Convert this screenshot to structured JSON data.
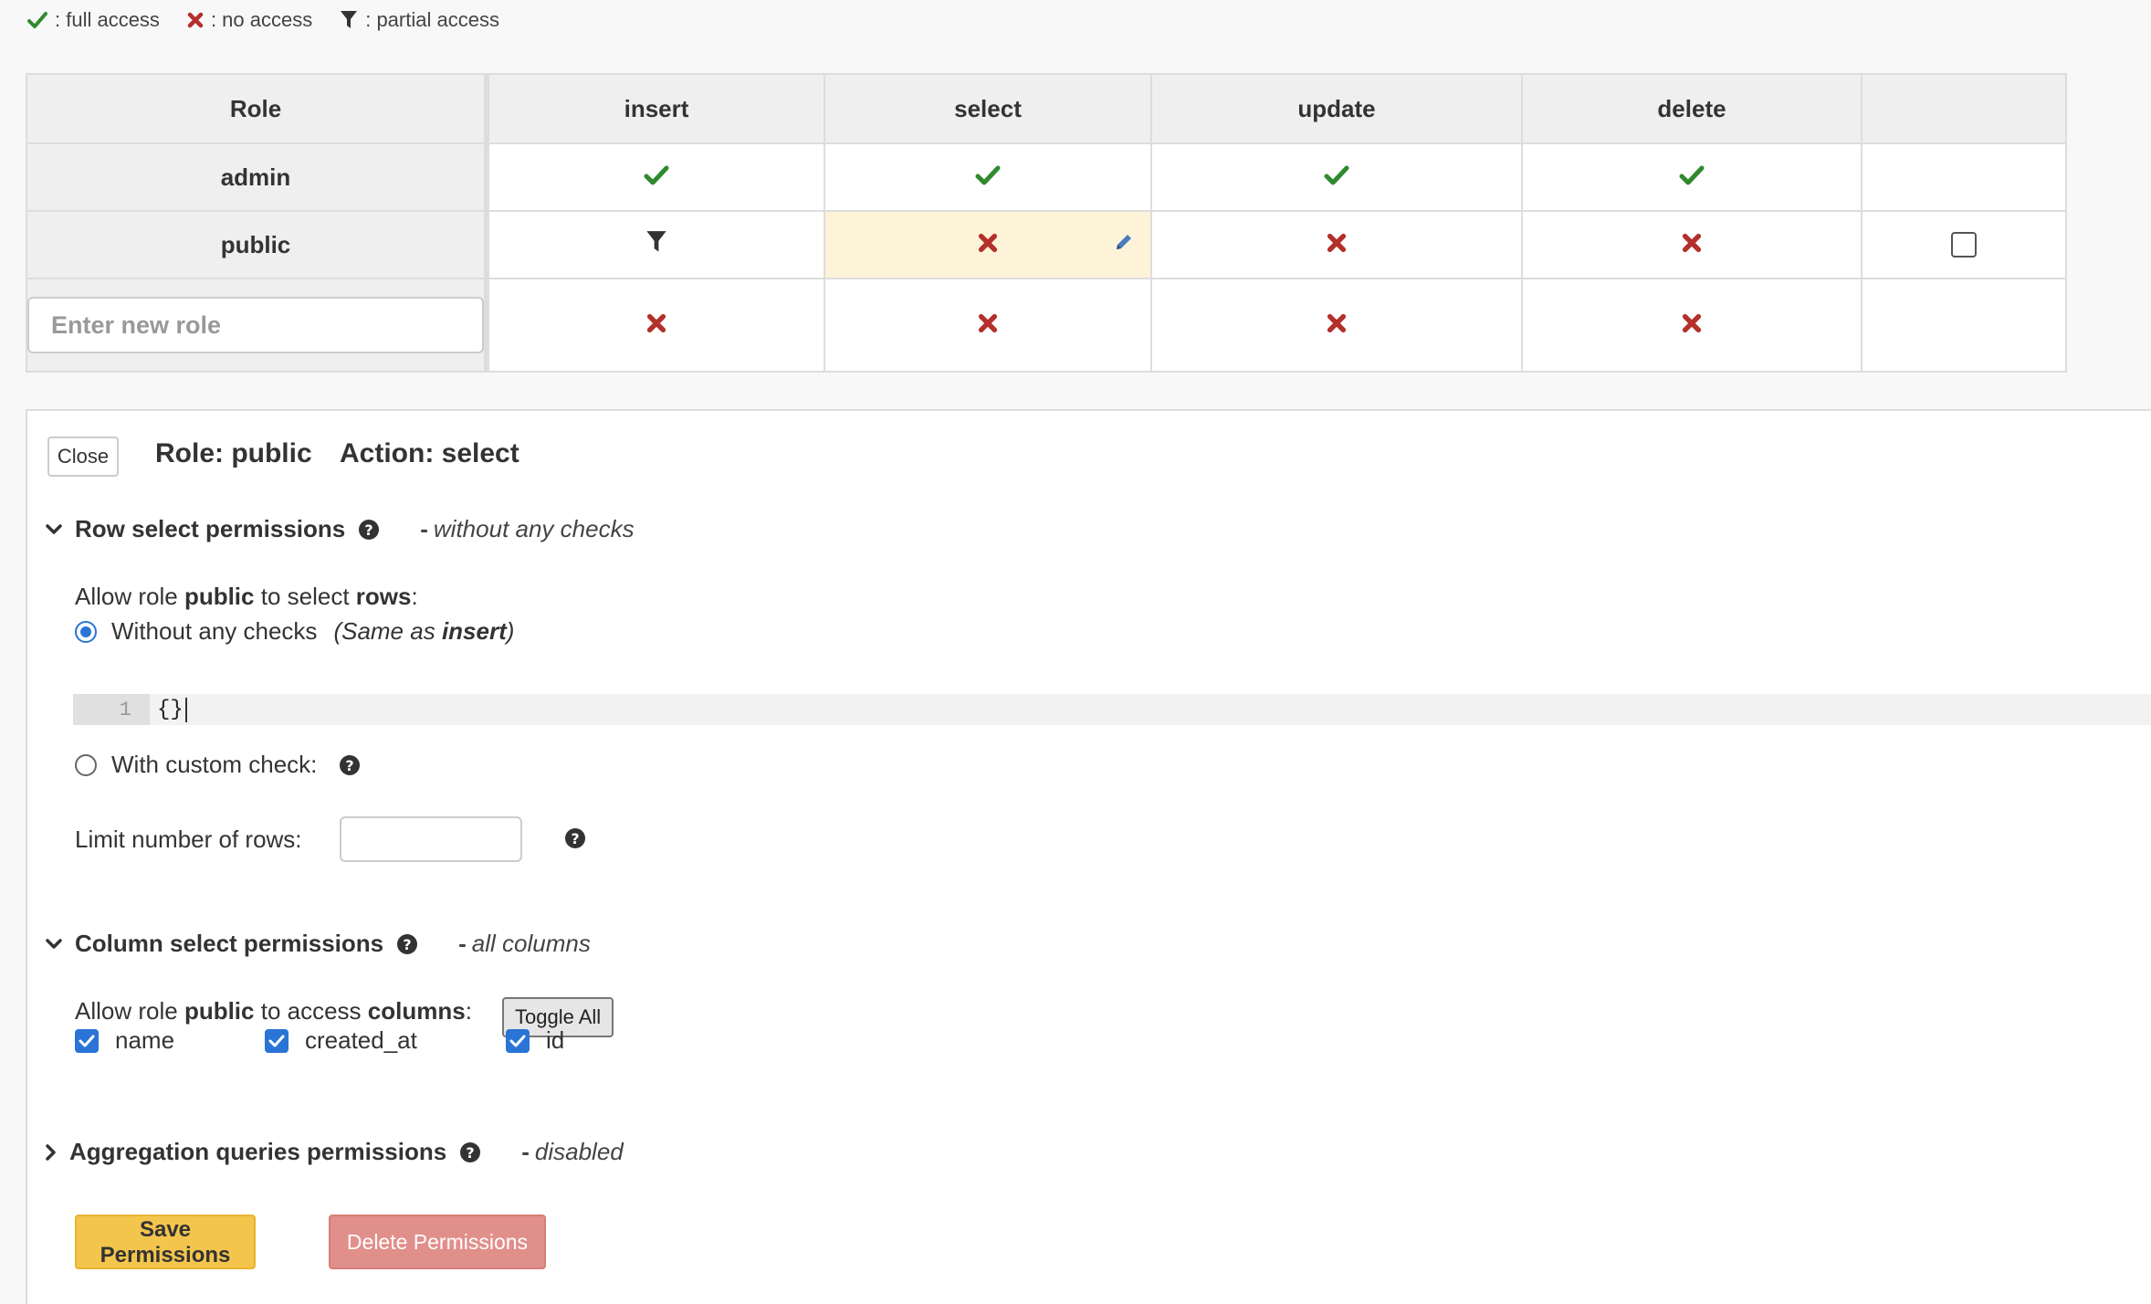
{
  "legend": {
    "full": ": full access",
    "none": ": no access",
    "partial": ": partial access"
  },
  "table": {
    "headers": [
      "Role",
      "insert",
      "select",
      "update",
      "delete",
      ""
    ],
    "rows": [
      {
        "role": "admin",
        "cells": [
          "check",
          "check",
          "check",
          "check"
        ]
      },
      {
        "role": "public",
        "cells": [
          "filter",
          "cross",
          "cross",
          "cross"
        ]
      }
    ],
    "new_role_placeholder": "Enter new role",
    "new_row_cells": [
      "cross",
      "cross",
      "cross",
      "cross"
    ]
  },
  "panel": {
    "close_label": "Close",
    "role_title": "Role: public",
    "action_title": "Action: select",
    "row_section": {
      "title": "Row select permissions",
      "note_dash": "-",
      "note": "without any checks",
      "allow_prefix": "Allow role ",
      "allow_role": "public",
      "allow_mid": " to select ",
      "allow_obj": "rows",
      "allow_suffix": ":",
      "option_without": "Without any checks",
      "same_as_prefix": "(Same as ",
      "same_as_bold": "insert",
      "same_as_suffix": ")",
      "editor_line": "1",
      "editor_code": "{}",
      "option_custom": "With custom check:",
      "limit_label": "Limit number of rows:"
    },
    "column_section": {
      "title": "Column select permissions",
      "note_dash": "-",
      "note": "all columns",
      "allow_prefix": "Allow role ",
      "allow_role": "public",
      "allow_mid": " to access ",
      "allow_obj": "columns",
      "allow_suffix": ":",
      "toggle_label": "Toggle All",
      "columns": [
        "name",
        "created_at",
        "id"
      ]
    },
    "aggregation_section": {
      "title": "Aggregation queries permissions",
      "note_dash": "-",
      "note": "disabled"
    },
    "save_label": "Save Permissions",
    "delete_label": "Delete Permissions"
  },
  "colors": {
    "check": "#2f8a2f",
    "cross": "#b3302b",
    "radio_accent": "#2a74d6",
    "save_bg": "#f4c54c",
    "delete_bg": "#e18f8b"
  }
}
